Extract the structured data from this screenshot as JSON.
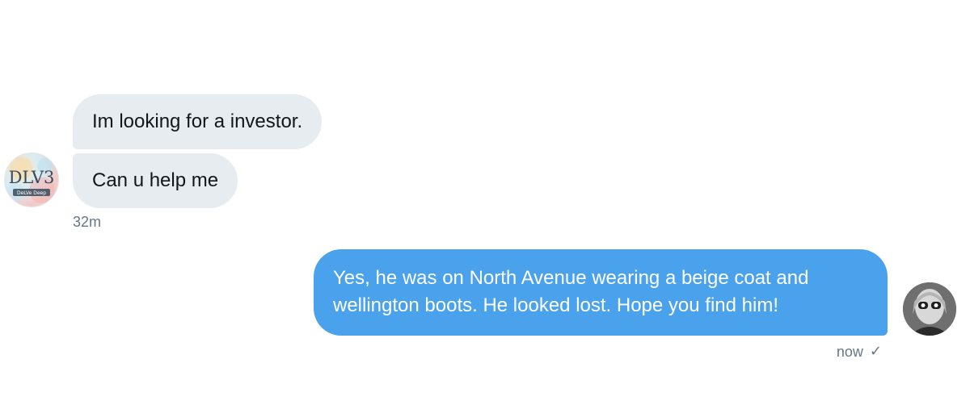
{
  "messages_incoming": [
    {
      "text": "Im looking for a investor."
    },
    {
      "text": "Can u help me"
    }
  ],
  "incoming_time": "32m",
  "messages_outgoing": [
    {
      "text": "Yes, he was on North Avenue wearing a beige coat and wellington boots. He looked lost. Hope you find him!"
    }
  ],
  "outgoing_time": "now",
  "read_receipt_icon": "checkmark-icon",
  "left_avatar_logo": {
    "title": "DLV3",
    "subtitle": "DeLVe Deep"
  },
  "colors": {
    "incoming_bubble": "#e6ecf0",
    "outgoing_bubble": "#4aa1ec",
    "timestamp": "#657786"
  }
}
